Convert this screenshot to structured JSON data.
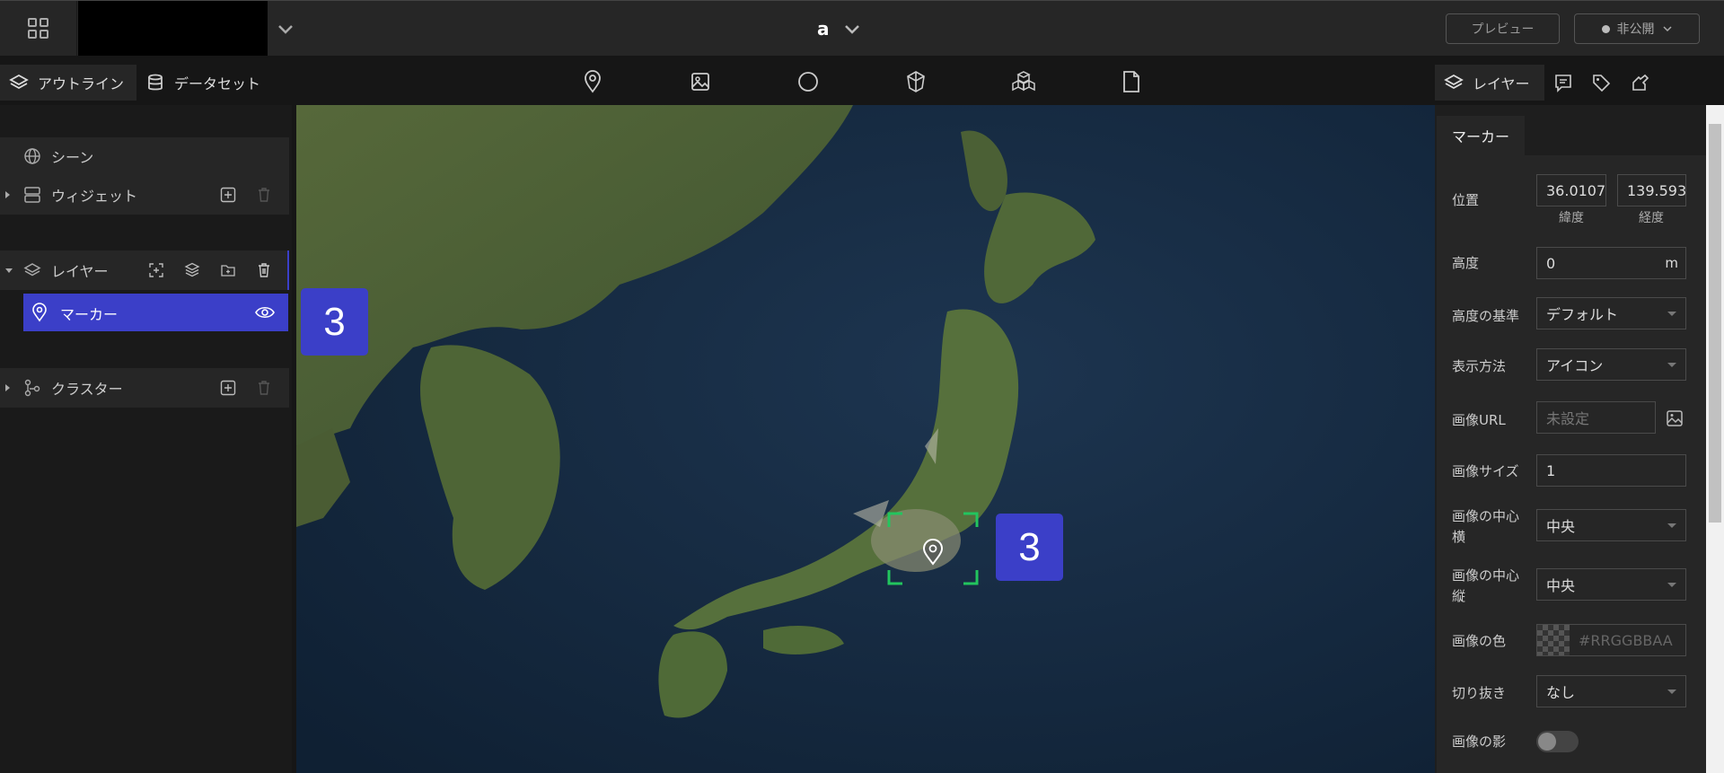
{
  "header": {
    "scene_name": "a",
    "preview_label": "プレビュー",
    "publish_label": "非公開"
  },
  "left_tabs": {
    "outline": "アウトライン",
    "dataset": "データセット"
  },
  "outline": {
    "scene": "シーン",
    "widget": "ウィジェット",
    "layers": "レイヤー",
    "marker": "マーカー",
    "cluster": "クラスター"
  },
  "toolbar_icons": [
    "marker-tool-icon",
    "image-tool-icon",
    "circle-tool-icon",
    "box-tool-icon",
    "model-tool-icon",
    "document-tool-icon"
  ],
  "right_tabs": {
    "layer": "レイヤー"
  },
  "props": {
    "tab": "マーカー",
    "position_label": "位置",
    "lat_value": "36.0107",
    "lng_value": "139.593",
    "lat_label": "緯度",
    "lng_label": "経度",
    "height_label": "高度",
    "height_value": "0",
    "height_unit": "m",
    "height_ref_label": "高度の基準",
    "height_ref_value": "デフォルト",
    "display_label": "表示方法",
    "display_value": "アイコン",
    "image_url_label": "画像URL",
    "image_url_placeholder": "未設定",
    "image_size_label": "画像サイズ",
    "image_size_value": "1",
    "image_center_x_label1": "画像の中心",
    "image_center_x_label2": "横",
    "image_center_x_value": "中央",
    "image_center_y_label1": "画像の中心",
    "image_center_y_label2": "縦",
    "image_center_y_value": "中央",
    "image_color_label": "画像の色",
    "image_color_placeholder": "#RRGGBBAA",
    "crop_label": "切り抜き",
    "crop_value": "なし",
    "shadow_label": "画像の影"
  },
  "badges": {
    "left": "3",
    "right": "3"
  },
  "colors": {
    "accent": "#3b3fc8",
    "selection": "#22c55e"
  }
}
